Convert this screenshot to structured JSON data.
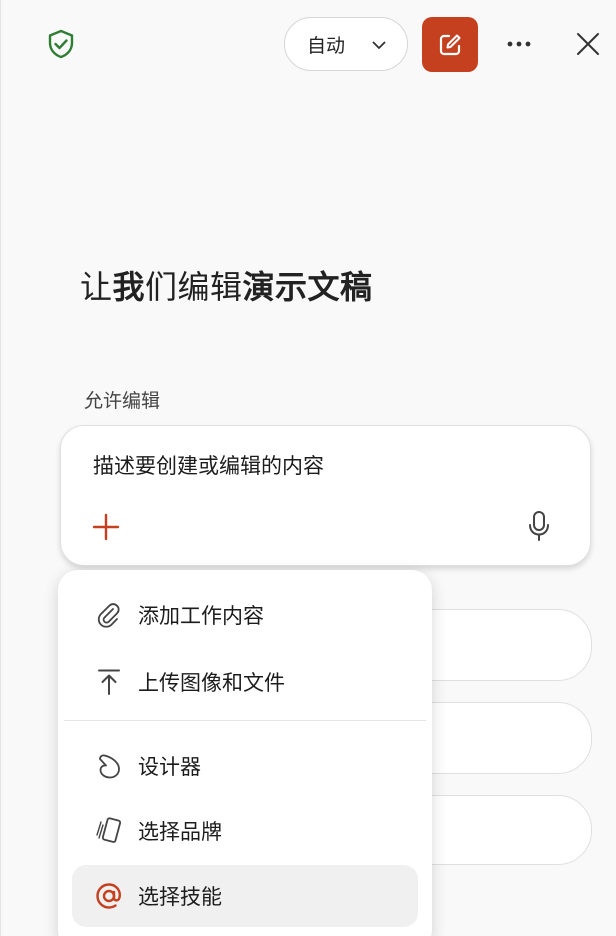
{
  "header": {
    "mode_select": {
      "value": "自动"
    }
  },
  "main": {
    "headline": {
      "part1": "让",
      "part2": "我",
      "part3": "们编辑",
      "part4": "演示文稿"
    },
    "allow_label": "允许编辑",
    "prompt": {
      "placeholder": "描述要创建或编辑的内容"
    }
  },
  "menu": {
    "items": [
      {
        "label": "添加工作内容",
        "icon": "paperclip-icon"
      },
      {
        "label": "上传图像和文件",
        "icon": "upload-icon"
      },
      {
        "label": "设计器",
        "icon": "designer-icon"
      },
      {
        "label": "选择品牌",
        "icon": "brand-icon"
      },
      {
        "label": "选择技能",
        "icon": "at-icon"
      }
    ]
  },
  "colors": {
    "accent": "#c4401f",
    "shield": "#2e7d32"
  }
}
